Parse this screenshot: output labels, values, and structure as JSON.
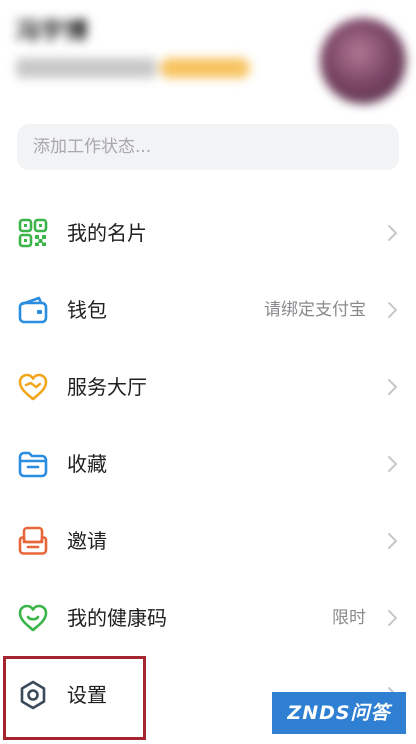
{
  "profile": {
    "name": "冯宇博"
  },
  "status_input": {
    "placeholder": "添加工作状态..."
  },
  "menu": [
    {
      "label": "我的名片",
      "value": "",
      "icon": "qr-code-icon",
      "color": "#3bb54a"
    },
    {
      "label": "钱包",
      "value": "请绑定支付宝",
      "icon": "wallet-icon",
      "color": "#2a8de0"
    },
    {
      "label": "服务大厅",
      "value": "",
      "icon": "service-hall-icon",
      "color": "#f2a51a"
    },
    {
      "label": "收藏",
      "value": "",
      "icon": "folder-icon",
      "color": "#2a8de0"
    },
    {
      "label": "邀请",
      "value": "",
      "icon": "invite-icon",
      "color": "#e8673a"
    },
    {
      "label": "我的健康码",
      "value": "限时",
      "icon": "health-heart-icon",
      "color": "#3bb54a"
    },
    {
      "label": "设置",
      "value": "",
      "icon": "gear-icon",
      "color": "#3a4a5a"
    }
  ],
  "watermark": {
    "text": "ZNDS问答"
  },
  "colors": {
    "highlight": "#a4252d",
    "chevron": "#c8c8cc",
    "secondary_text": "#8a8a8e"
  }
}
